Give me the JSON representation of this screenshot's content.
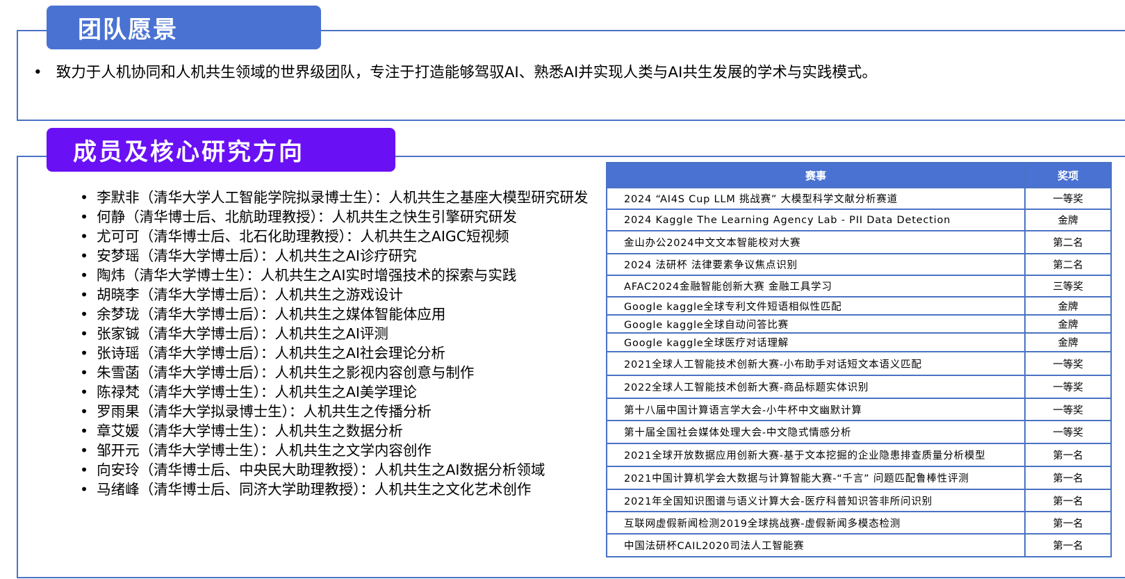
{
  "vision": {
    "title": "团队愿景",
    "bullet_marker": "•",
    "text": "致力于人机协同和人机共生领域的世界级团队，专注于打造能够驾驭AI、熟悉AI并实现人类与AI共生发展的学术与实践模式。"
  },
  "members": {
    "title": "成员及核心研究方向",
    "items": [
      "李默非（清华大学人工智能学院拟录博士生）：人机共生之基座大模型研究研发",
      "何静（清华博士后、北航助理教授）：人机共生之快生引擎研究研发",
      "尤可可（清华博士后、北石化助理教授）：人机共生之AIGC短视频",
      "安梦瑶（清华大学博士后）：人机共生之AI诊疗研究",
      "陶炜（清华大学博士生）：人机共生之AI实时增强技术的探索与实践",
      "胡晓李（清华大学博士后）：人机共生之游戏设计",
      "余梦珑（清华大学博士后）：人机共生之媒体智能体应用",
      "张家铖（清华大学博士后）：人机共生之AI评测",
      "张诗瑶（清华大学博士后）：人机共生之AI社会理论分析",
      "朱雪菡（清华大学博士后）：人机共生之影视内容创意与制作",
      "陈禄梵（清华大学博士生）：人机共生之AI美学理论",
      "罗雨果（清华大学拟录博士生）：人机共生之传播分析",
      "章艾媛（清华大学博士生）：人机共生之数据分析",
      "邹开元（清华大学博士生）：人机共生之文学内容创作",
      "向安玲（清华博士后、中央民大助理教授）：人机共生之AI数据分析领域",
      "马绪峰（清华博士后、同济大学助理教授）：人机共生之文化艺术创作"
    ]
  },
  "awards": {
    "headers": {
      "event": "赛事",
      "prize": "奖项"
    },
    "rows": [
      {
        "event": "2024 “AI4S Cup LLM 挑战赛” 大模型科学文献分析赛道",
        "prize": "一等奖"
      },
      {
        "event": "2024 Kaggle The Learning Agency Lab - PII Data Detection",
        "prize": "金牌"
      },
      {
        "event": "金山办公2024中文文本智能校对大赛",
        "prize": "第二名"
      },
      {
        "event": "2024 法研杯 法律要素争议焦点识别",
        "prize": "第二名"
      },
      {
        "event": "AFAC2024金融智能创新大赛 金融工具学习",
        "prize": "三等奖"
      },
      {
        "event": "Google kaggle全球专利文件短语相似性匹配",
        "prize": "金牌"
      },
      {
        "event": "Google kaggle全球自动问答比赛",
        "prize": "金牌"
      },
      {
        "event": "Google kaggle全球医疗对话理解",
        "prize": "金牌"
      },
      {
        "event": "2021全球人工智能技术创新大赛-小布助手对话短文本语义匹配",
        "prize": "一等奖"
      },
      {
        "event": "2022全球人工智能技术创新大赛-商品标题实体识别",
        "prize": "一等奖"
      },
      {
        "event": "第十八届中国计算语言学大会-小牛杯中文幽默计算",
        "prize": "一等奖"
      },
      {
        "event": "第十届全国社会媒体处理大会-中文隐式情感分析",
        "prize": "一等奖"
      },
      {
        "event": "2021全球开放数据应用创新大赛-基于文本挖掘的企业隐患排查质量分析模型",
        "prize": "第一名"
      },
      {
        "event": "2021中国计算机学会大数据与计算智能大赛-“千言” 问题匹配鲁棒性评测",
        "prize": "第一名"
      },
      {
        "event": "2021年全国知识图谱与语义计算大会-医疗科普知识答非所问识别",
        "prize": "第一名"
      },
      {
        "event": "互联网虚假新闻检测2019全球挑战赛-虚假新闻多模态检测",
        "prize": "第一名"
      },
      {
        "event": "中国法研杯CAIL2020司法人工智能赛",
        "prize": "第一名"
      }
    ]
  },
  "colors": {
    "frame": "#4a72c4",
    "vision_title_bg": "#4a72d2",
    "members_title_bg": "#6a10f5",
    "table_header_bg": "#4a72d2"
  }
}
